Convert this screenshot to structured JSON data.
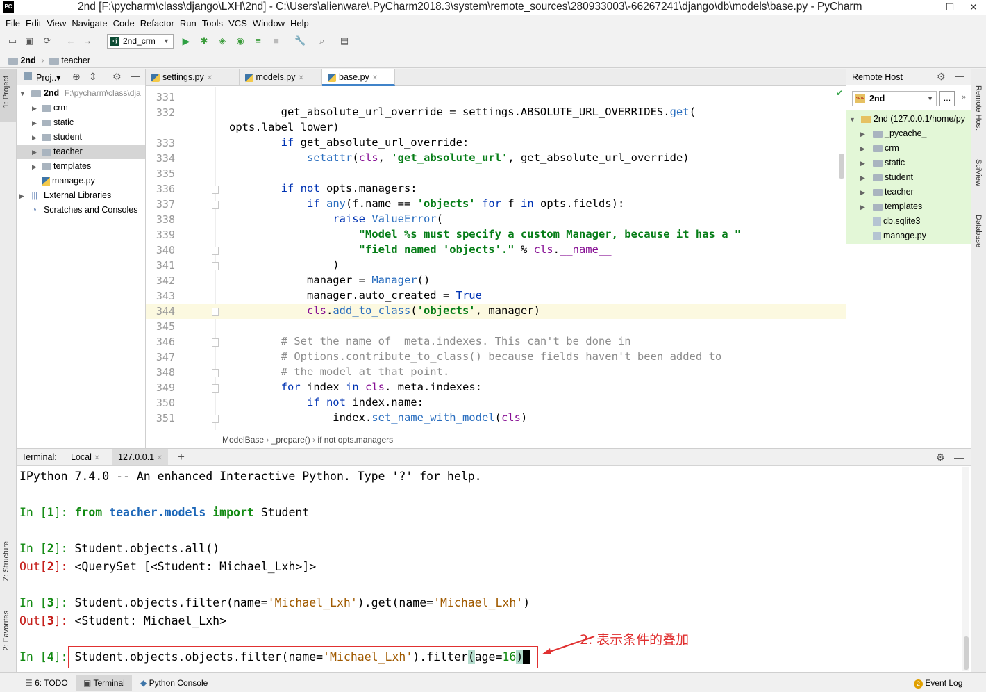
{
  "window": {
    "title": "2nd [F:\\pycharm\\class\\django\\LXH\\2nd] - C:\\Users\\alienware\\.PyCharm2018.3\\system\\remote_sources\\280933003\\-66267241\\django\\db\\models\\base.py - PyCharm",
    "app_icon": "PC",
    "minimize": "—",
    "maximize": "☐",
    "close": "✕"
  },
  "menu": [
    "File",
    "Edit",
    "View",
    "Navigate",
    "Code",
    "Refactor",
    "Run",
    "Tools",
    "VCS",
    "Window",
    "Help"
  ],
  "toolbar": {
    "run_config": "2nd_crm"
  },
  "navbar": {
    "root": "2nd",
    "child": "teacher"
  },
  "left_strip": {
    "project": "1: Project",
    "structure": "Z: Structure",
    "favorites": "2: Favorites"
  },
  "right_strip": {
    "remote_host": "Remote Host",
    "sciview": "SciView",
    "database": "Database"
  },
  "project_panel": {
    "header": "Proj..▾",
    "root_name": "2nd",
    "root_path": "F:\\pycharm\\class\\dja",
    "items": [
      {
        "label": "crm",
        "expandable": true,
        "type": "folder"
      },
      {
        "label": "static",
        "expandable": true,
        "type": "folder"
      },
      {
        "label": "student",
        "expandable": true,
        "type": "folder"
      },
      {
        "label": "teacher",
        "expandable": true,
        "type": "folder",
        "selected": true
      },
      {
        "label": "templates",
        "expandable": true,
        "type": "folder"
      },
      {
        "label": "manage.py",
        "expandable": false,
        "type": "file"
      }
    ],
    "external": "External Libraries",
    "scratches": "Scratches and Consoles"
  },
  "editor": {
    "tabs": [
      {
        "label": "settings.py",
        "active": false
      },
      {
        "label": "models.py",
        "active": false
      },
      {
        "label": "base.py",
        "active": true
      }
    ],
    "highlight_line": "344",
    "lines": [
      {
        "n": "331",
        "html": ""
      },
      {
        "n": "332",
        "html": "        get_absolute_url_override = settings.ABSOLUTE_URL_OVERRIDES.<span class='bi'>get</span>("
      },
      {
        "n": "",
        "html": "opts.label_lower)"
      },
      {
        "n": "333",
        "html": "        <span class='kw'>if</span> get_absolute_url_override:"
      },
      {
        "n": "334",
        "html": "            <span class='bi'>setattr</span>(<span class='sp'>cls</span>, <span class='str'>'get_absolute_url'</span>, get_absolute_url_override)"
      },
      {
        "n": "335",
        "html": ""
      },
      {
        "n": "336",
        "html": "        <span class='kw'>if not</span> opts.managers:"
      },
      {
        "n": "337",
        "html": "            <span class='kw'>if</span> <span class='bi'>any</span>(f.name == <span class='str'>'objects'</span> <span class='kw'>for</span> f <span class='kw'>in</span> opts.fields):"
      },
      {
        "n": "338",
        "html": "                <span class='kw'>raise</span> <span class='bi'>ValueError</span>("
      },
      {
        "n": "339",
        "html": "                    <span class='str'>\"Model %s must specify a custom Manager, because it has a \"</span>"
      },
      {
        "n": "340",
        "html": "                    <span class='str'>\"field named 'objects'.\"</span> % <span class='sp'>cls</span>.<span class='sp'>__name__</span>"
      },
      {
        "n": "341",
        "html": "                )"
      },
      {
        "n": "342",
        "html": "            manager = <span class='bi'>Manager</span>()"
      },
      {
        "n": "343",
        "html": "            manager.auto_created = <span class='kw'>True</span>"
      },
      {
        "n": "344",
        "html": "            <span class='sp'>cls</span>.<span class='bi'>add_to_class</span>(<span class='str'>'objects'</span>, manager)"
      },
      {
        "n": "345",
        "html": ""
      },
      {
        "n": "346",
        "html": "        <span class='cm'># Set the name of _meta.indexes. This can't be done in</span>"
      },
      {
        "n": "347",
        "html": "        <span class='cm'># Options.contribute_to_class() because fields haven't been added to</span>"
      },
      {
        "n": "348",
        "html": "        <span class='cm'># the model at that point.</span>"
      },
      {
        "n": "349",
        "html": "        <span class='kw'>for</span> index <span class='kw'>in</span> <span class='sp'>cls</span>._meta.indexes:"
      },
      {
        "n": "350",
        "html": "            <span class='kw'>if not</span> index.name:"
      },
      {
        "n": "351",
        "html": "                index.<span class='bi'>set_name_with_model</span>(<span class='sp'>cls</span>)"
      }
    ],
    "breadcrumb": [
      "ModelBase",
      "_prepare()",
      "if not opts.managers"
    ]
  },
  "remote_host": {
    "title": "Remote Host",
    "selector": "2nd",
    "browse": "...",
    "root": "2nd (127.0.0.1/home/py",
    "items": [
      {
        "label": "_pycache_",
        "expandable": true,
        "type": "folder"
      },
      {
        "label": "crm",
        "expandable": true,
        "type": "folder"
      },
      {
        "label": "static",
        "expandable": true,
        "type": "folder"
      },
      {
        "label": "student",
        "expandable": true,
        "type": "folder"
      },
      {
        "label": "teacher",
        "expandable": true,
        "type": "folder"
      },
      {
        "label": "templates",
        "expandable": true,
        "type": "folder"
      },
      {
        "label": "db.sqlite3",
        "expandable": false,
        "type": "file"
      },
      {
        "label": "manage.py",
        "expandable": false,
        "type": "file"
      }
    ]
  },
  "terminal": {
    "label": "Terminal:",
    "tabs": [
      "Local",
      "127.0.0.1"
    ],
    "add": "+",
    "banner": "IPython 7.4.0 -- An enhanced Interactive Python. Type '?' for help.",
    "annotation": "2. 表示条件的叠加"
  },
  "statusbar": {
    "todo": "6: TODO",
    "terminal": "Terminal",
    "python_console": "Python Console",
    "event_badge": "2",
    "event_log": "Event Log"
  },
  "colors": {
    "accent": "#4083c9",
    "remote_bg": "#e3f7d7",
    "annotation": "#e03030",
    "current_line": "#fcf9e0"
  }
}
